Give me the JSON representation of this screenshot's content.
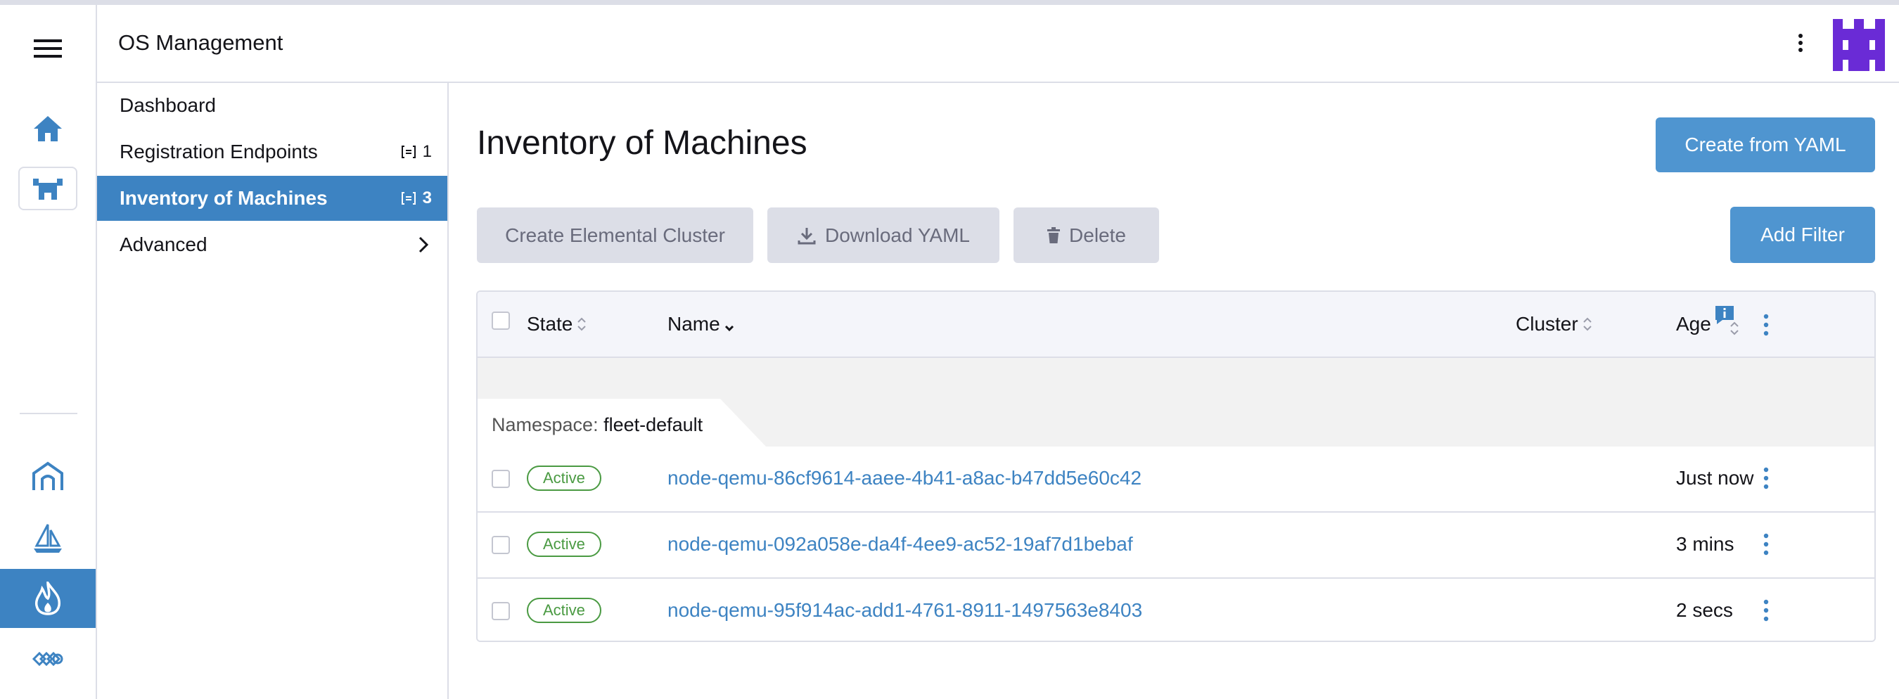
{
  "header": {
    "title": "OS Management"
  },
  "nav": {
    "items": [
      {
        "label": "Dashboard",
        "count": ""
      },
      {
        "label": "Registration Endpoints",
        "count": "1"
      },
      {
        "label": "Inventory of Machines",
        "count": "3"
      },
      {
        "label": "Advanced",
        "count": ""
      }
    ]
  },
  "page": {
    "title": "Inventory of Machines",
    "create_yaml": "Create from YAML",
    "create_cluster": "Create Elemental Cluster",
    "download_yaml": "Download YAML",
    "delete": "Delete",
    "add_filter": "Add Filter"
  },
  "table": {
    "columns": {
      "state": "State",
      "name": "Name",
      "cluster": "Cluster",
      "age": "Age"
    },
    "group": {
      "prefix": "Namespace:",
      "value": "fleet-default"
    },
    "rows": [
      {
        "state": "Active",
        "name": "node-qemu-86cf9614-aaee-4b41-a8ac-b47dd5e60c42",
        "cluster": "",
        "age": "Just now"
      },
      {
        "state": "Active",
        "name": "node-qemu-092a058e-da4f-4ee9-ac52-19af7d1bebaf",
        "cluster": "",
        "age": "3 mins"
      },
      {
        "state": "Active",
        "name": "node-qemu-95f914ac-add1-4761-8911-1497563e8403",
        "cluster": "",
        "age": "2 secs"
      }
    ]
  },
  "colors": {
    "accent": "#3d83c2",
    "primary_button": "#4f95d0",
    "active_green": "#4a9a42",
    "avatar": "#6a2bd6"
  }
}
